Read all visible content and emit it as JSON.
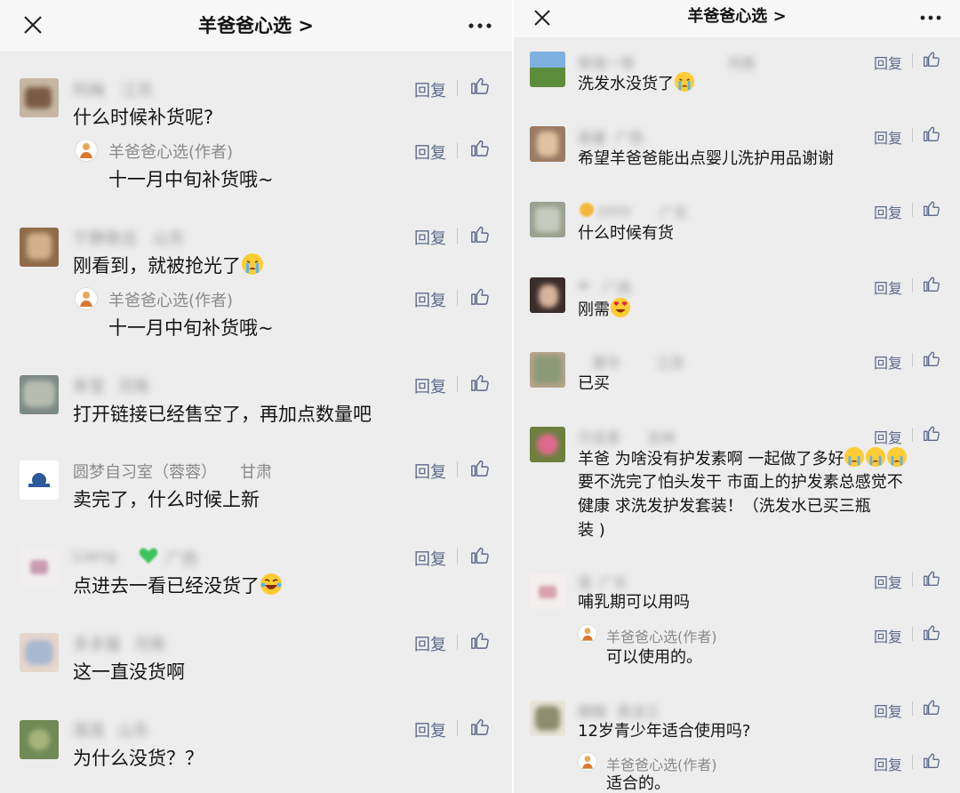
{
  "left": {
    "title": "羊爸爸心选 >",
    "comments": [
      {
        "name": "阿梅",
        "location": "江苏",
        "text": "什么时候补货呢?",
        "reply": {
          "name": "羊爸爸心选(作者)",
          "text": "十一月中旬补货哦~"
        }
      },
      {
        "name": "宁静致远",
        "location": "山东",
        "text": "刚看到，就被抢光了",
        "reply": {
          "name": "羊爸爸心选(作者)",
          "text": "十一月中旬补货哦~"
        }
      },
      {
        "name": "朱莹",
        "location": "河南",
        "text": "打开链接已经售空了，再加点数量吧"
      },
      {
        "name": "圆梦自习室（蓉蓉）",
        "location": "甘肃",
        "text": "卖完了，什么时候上新"
      },
      {
        "name": "Liang",
        "location": "广西",
        "text": "点进去一看已经没货了"
      },
      {
        "name": "多多猫",
        "location": "河南",
        "text": "这一直没货啊"
      },
      {
        "name": "莲莲",
        "location": "山东",
        "text": "为什么没货？？"
      }
    ]
  },
  "right": {
    "title": "羊爸爸心选 >",
    "comments": [
      {
        "name": "等我一等",
        "location": "河南",
        "text": "洗发水没货了"
      },
      {
        "name": "蓓蕾",
        "location": "广西",
        "text": "希望羊爸爸能出点婴儿洗护用品谢谢"
      },
      {
        "name": "yyyy",
        "location": "广东",
        "text": "什么时候有货"
      },
      {
        "name": "w",
        "location": "广西",
        "text": "刚需"
      },
      {
        "name": "蓉华",
        "location": "江苏",
        "text": "已买"
      },
      {
        "name": "万佳恩",
        "location": "吉林",
        "text_lines": [
          "羊爸 为啥没有护发素啊 一起做了多好",
          "要不洗完了怕头发干 市面上的护发素总感觉不",
          "健康 求洗发护发套装！（洗发水已买三瓶",
          "装 )"
        ]
      },
      {
        "name": "莲",
        "location": "广东",
        "text": "哺乳期可以用吗",
        "reply": {
          "name": "羊爸爸心选(作者)",
          "text": "可以使用的。"
        }
      },
      {
        "name": "楠楠",
        "location": "黑龙江",
        "text": "12岁青少年适合使用吗?",
        "reply": {
          "name": "羊爸爸心选(作者)",
          "text": "适合的。"
        }
      }
    ]
  },
  "reply_label": "回复",
  "colors": {
    "accent": "#5d6a8c",
    "background": "#ededed",
    "header": "#f7f7f7"
  },
  "icons": [
    "close-icon",
    "more-icon",
    "like-icon",
    "author-avatar-icon",
    "cry-emoji",
    "heart-eyes-emoji",
    "sunglasses-emoji",
    "laugh-cry-emoji"
  ]
}
